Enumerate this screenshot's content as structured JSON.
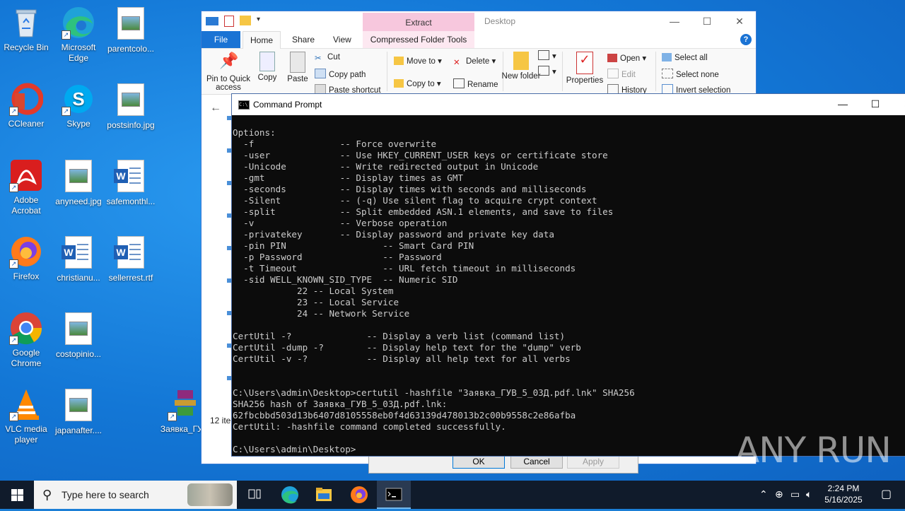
{
  "desktop": {
    "icons": [
      {
        "label": "Recycle Bin",
        "icon": "recycle-bin-icon"
      },
      {
        "label": "Microsoft Edge",
        "icon": "edge-icon"
      },
      {
        "label": "parentcolo...",
        "icon": "image-file-icon"
      },
      {
        "label": "CCleaner",
        "icon": "ccleaner-icon"
      },
      {
        "label": "Skype",
        "icon": "skype-icon"
      },
      {
        "label": "postsinfo.jpg",
        "icon": "image-file-icon"
      },
      {
        "label": "Adobe Acrobat",
        "icon": "acrobat-icon"
      },
      {
        "label": "anyneed.jpg",
        "icon": "image-file-icon"
      },
      {
        "label": "safemonthl...",
        "icon": "word-doc-icon"
      },
      {
        "label": "Firefox",
        "icon": "firefox-icon"
      },
      {
        "label": "christianu...",
        "icon": "word-doc-icon"
      },
      {
        "label": "sellerrest.rtf",
        "icon": "word-doc-icon"
      },
      {
        "label": "Google Chrome",
        "icon": "chrome-icon"
      },
      {
        "label": "costopinio...",
        "icon": "image-file-icon"
      },
      {
        "label": "VLC media player",
        "icon": "vlc-icon"
      },
      {
        "label": "japanafter....",
        "icon": "image-file-icon"
      },
      {
        "label": "Заявка_ГУ...",
        "icon": "winrar-archive-icon"
      }
    ]
  },
  "explorer": {
    "title": "Desktop",
    "extract_label": "Extract",
    "tabs": {
      "file": "File",
      "home": "Home",
      "share": "Share",
      "view": "View",
      "compressed": "Compressed Folder Tools"
    },
    "ribbon": {
      "pin": "Pin to Quick access",
      "copy": "Copy",
      "paste": "Paste",
      "cut": "Cut",
      "copy_path": "Copy path",
      "paste_shortcut": "Paste shortcut",
      "move_to": "Move to",
      "copy_to": "Copy to",
      "delete": "Delete",
      "rename": "Rename",
      "new_folder": "New folder",
      "properties": "Properties",
      "open": "Open",
      "edit": "Edit",
      "history": "History",
      "select_all": "Select all",
      "select_none": "Select none",
      "invert_selection": "Invert selection"
    },
    "items_count": "12 ite"
  },
  "dialog": {
    "ok": "OK",
    "cancel": "Cancel",
    "apply": "Apply"
  },
  "cmd": {
    "title": "Command Prompt",
    "output": "Options:\n  -f                -- Force overwrite\n  -user             -- Use HKEY_CURRENT_USER keys or certificate store\n  -Unicode          -- Write redirected output in Unicode\n  -gmt              -- Display times as GMT\n  -seconds          -- Display times with seconds and milliseconds\n  -Silent           -- (-q) Use silent flag to acquire crypt context\n  -split            -- Split embedded ASN.1 elements, and save to files\n  -v                -- Verbose operation\n  -privatekey       -- Display password and private key data\n  -pin PIN                  -- Smart Card PIN\n  -p Password               -- Password\n  -t Timeout                -- URL fetch timeout in milliseconds\n  -sid WELL_KNOWN_SID_TYPE  -- Numeric SID\n            22 -- Local System\n            23 -- Local Service\n            24 -- Network Service\n\nCertUtil -?              -- Display a verb list (command list)\nCertUtil -dump -?        -- Display help text for the \"dump\" verb\nCertUtil -v -?           -- Display all help text for all verbs\n\n\nC:\\Users\\admin\\Desktop>certutil -hashfile \"Заявка_ГУВ_5_03Д.pdf.lnk\" SHA256\nSHA256 hash of Заявка_ГУВ_5_03Д.pdf.lnk:\n62fbcbbd503d13b6407d8105558eb0f4d63139d478013b2c00b9558c2e86afba\nCertUtil: -hashfile command completed successfully.\n\nC:\\Users\\admin\\Desktop>"
  },
  "watermark": "ANY RUN",
  "taskbar": {
    "search_placeholder": "Type here to search",
    "apps": [
      "task-view-icon",
      "edge-icon",
      "file-explorer-icon",
      "firefox-icon",
      "command-prompt-icon"
    ],
    "time": "2:24 PM",
    "date": "5/16/2025"
  },
  "colors": {
    "desktop_bg": "#1b7fd6",
    "taskbar": "#101b2b",
    "cmd_bg": "#0c0c0c",
    "cmd_text": "#cccccc",
    "extract_tab": "#f7c7dd"
  }
}
